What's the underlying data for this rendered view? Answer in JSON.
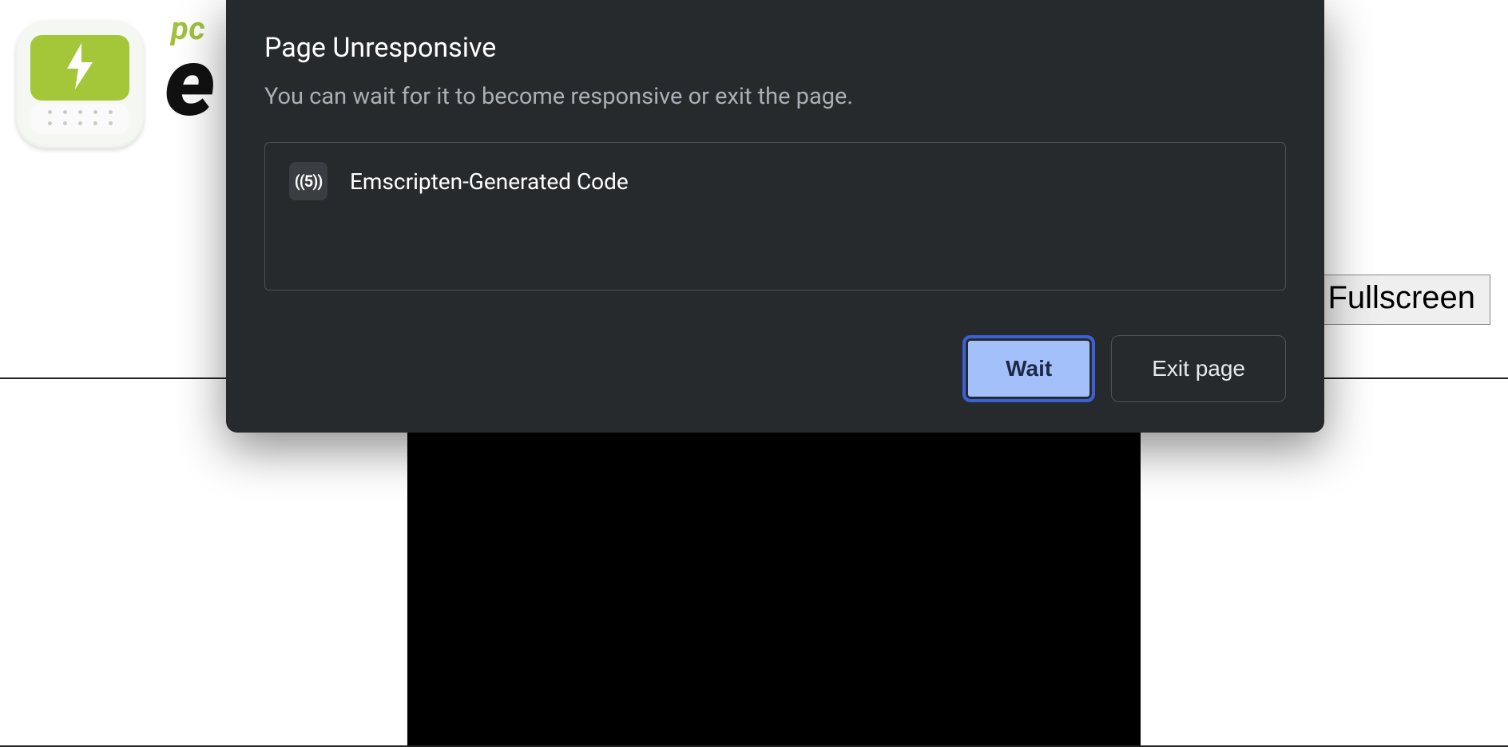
{
  "page": {
    "wordmark_small": "pc",
    "wordmark_big": "e",
    "fullscreen_label": "Fullscreen"
  },
  "dialog": {
    "title": "Page Unresponsive",
    "subtitle": "You can wait for it to become responsive or exit the page.",
    "pages": [
      {
        "favicon_text": "((5))",
        "name": "Emscripten-Generated Code"
      }
    ],
    "wait_label": "Wait",
    "exit_label": "Exit page"
  }
}
